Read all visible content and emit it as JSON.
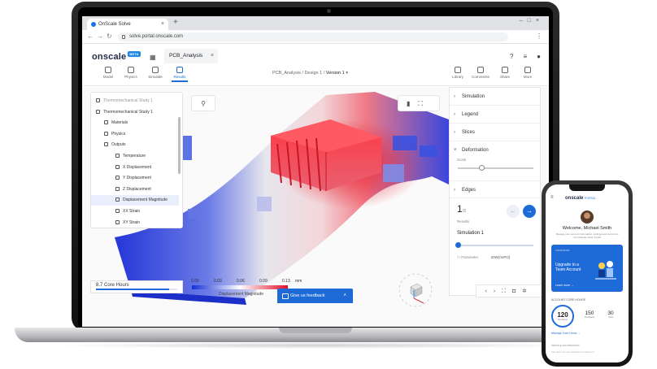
{
  "browser": {
    "tab_title": "OnScale Solve",
    "new_tab": "+",
    "url": "solve.portal.onscale.com"
  },
  "app": {
    "logo": "onscale",
    "beta": "BETA",
    "project_tab": "PCB_Analysis",
    "toolbar": [
      {
        "label": "Model",
        "active": false
      },
      {
        "label": "Physics",
        "active": false
      },
      {
        "label": "Simulate",
        "active": false
      },
      {
        "label": "Results",
        "active": true
      }
    ],
    "right_tools": [
      "Library",
      "Comments",
      "Share",
      "More"
    ],
    "breadcrumb": {
      "project": "PCB_Analysis",
      "sep1": "/",
      "design": "Design 1",
      "sep2": "/",
      "version": "Version 1"
    }
  },
  "tree": [
    {
      "label": "Thermomechanical Study 1",
      "level": 0,
      "dim": true
    },
    {
      "label": "Thermomechanical Study 1",
      "level": 0
    },
    {
      "label": "Materials",
      "level": 1
    },
    {
      "label": "Physics",
      "level": 1
    },
    {
      "label": "Outputs",
      "level": 1
    },
    {
      "label": "Temperature",
      "level": 2
    },
    {
      "label": "X Displacement",
      "level": 2
    },
    {
      "label": "Y Displacement",
      "level": 2
    },
    {
      "label": "Z Displacement",
      "level": 2
    },
    {
      "label": "Displacement Magnitude",
      "level": 2,
      "selected": true
    },
    {
      "label": "XX Strain",
      "level": 2
    },
    {
      "label": "XY Strain",
      "level": 2
    }
  ],
  "right_panel": {
    "sections": [
      "Simulation",
      "Legend",
      "Slices",
      "Deformation",
      "Edges"
    ],
    "scale_label": "Scale",
    "results_count": "1",
    "results_total": "3",
    "results_label": "Results",
    "simulation_label": "Simulation 1",
    "parameter_label": "Parameter",
    "parameter_value": "20W(/mPO)"
  },
  "core_hours": {
    "label": "8.7 Core Hours",
    "fraction": 0.9
  },
  "legend": {
    "ticks": [
      "0.00",
      "0.03",
      "0.06",
      "0.09",
      "0.13"
    ],
    "unit": "mm",
    "title": "Displacement Magnitude",
    "colors": [
      "#1530d6",
      "#ffffff",
      "#e0102a"
    ]
  },
  "feedback": {
    "label": "Give us feedback"
  },
  "phone": {
    "logo": "onscale",
    "logo_sub": "PORTAL",
    "welcome": "Welcome, Michael Smith",
    "subtitle": "Manage your account information, settings and more from the OnScale Solve Portal",
    "card_kicker": "YOUR PLAN",
    "card_title": "Upgrade to a Team Account",
    "card_link": "Learn more",
    "usage_title": "ACCOUNT CORE HOURS",
    "stat_main": "120",
    "stat_main_label": "Remaining",
    "stat_2": "150",
    "stat_2_label": "Purchased",
    "stat_3": "30",
    "stat_3_label": "Used",
    "manage_link": "Manage Core Hours",
    "section2": "PROFILE INFORMATION",
    "section2_text": "You have not yet submitted a method of"
  }
}
